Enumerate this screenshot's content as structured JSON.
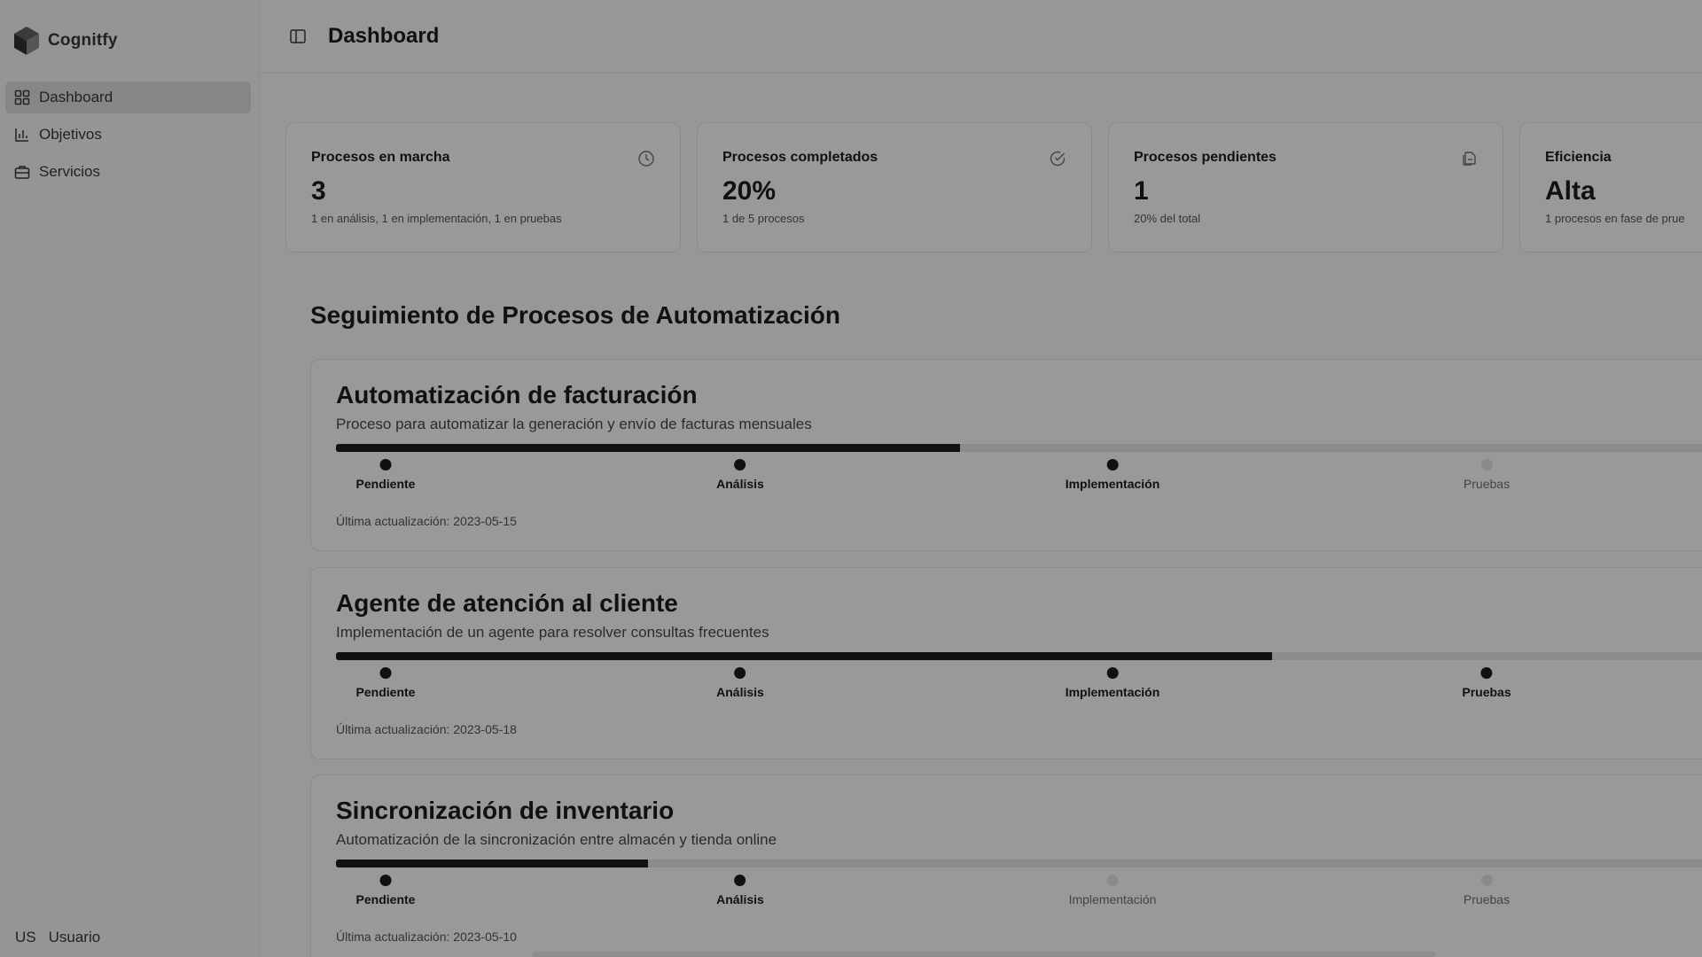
{
  "brand": {
    "name": "Cognitfy"
  },
  "sidebar": {
    "items": [
      {
        "label": "Dashboard",
        "icon": "dashboard-grid-icon",
        "active": true
      },
      {
        "label": "Objetivos",
        "icon": "bar-chart-icon",
        "active": false
      },
      {
        "label": "Servicios",
        "icon": "briefcase-icon",
        "active": false
      }
    ],
    "user": {
      "initials": "US",
      "name": "Usuario"
    }
  },
  "header": {
    "title": "Dashboard"
  },
  "stats": [
    {
      "title": "Procesos en marcha",
      "value": "3",
      "desc": "1 en análisis, 1 en implementación, 1 en pruebas",
      "icon": "clock-icon"
    },
    {
      "title": "Procesos completados",
      "value": "20%",
      "desc": "1 de 5 procesos",
      "icon": "check-circle-icon"
    },
    {
      "title": "Procesos pendientes",
      "value": "1",
      "desc": "20% del total",
      "icon": "file-copy-icon"
    },
    {
      "title": "Eficiencia",
      "value": "Alta",
      "desc": "1 procesos en fase de prue",
      "icon": ""
    }
  ],
  "section": {
    "title": "Seguimiento de Procesos de Automatización"
  },
  "processes": [
    {
      "title": "Automatización de facturación",
      "desc": "Proceso para automatizar la generación y envío de facturas mensuales",
      "progress": 0.448,
      "stages": [
        {
          "label": "Pendiente",
          "done": true
        },
        {
          "label": "Análisis",
          "done": true
        },
        {
          "label": "Implementación",
          "done": true
        },
        {
          "label": "Pruebas",
          "done": false
        }
      ],
      "updated": "Última actualización: 2023-05-15"
    },
    {
      "title": "Agente de atención al cliente",
      "desc": "Implementación de un agente para resolver consultas frecuentes",
      "progress": 0.672,
      "stages": [
        {
          "label": "Pendiente",
          "done": true
        },
        {
          "label": "Análisis",
          "done": true
        },
        {
          "label": "Implementación",
          "done": true
        },
        {
          "label": "Pruebas",
          "done": true
        }
      ],
      "updated": "Última actualización: 2023-05-18"
    },
    {
      "title": "Sincronización de inventario",
      "desc": "Automatización de la sincronización entre almacén y tienda online",
      "progress": 0.224,
      "stages": [
        {
          "label": "Pendiente",
          "done": true
        },
        {
          "label": "Análisis",
          "done": true
        },
        {
          "label": "Implementación",
          "done": false
        },
        {
          "label": "Pruebas",
          "done": false
        }
      ],
      "updated": "Última actualización: 2023-05-10"
    }
  ]
}
